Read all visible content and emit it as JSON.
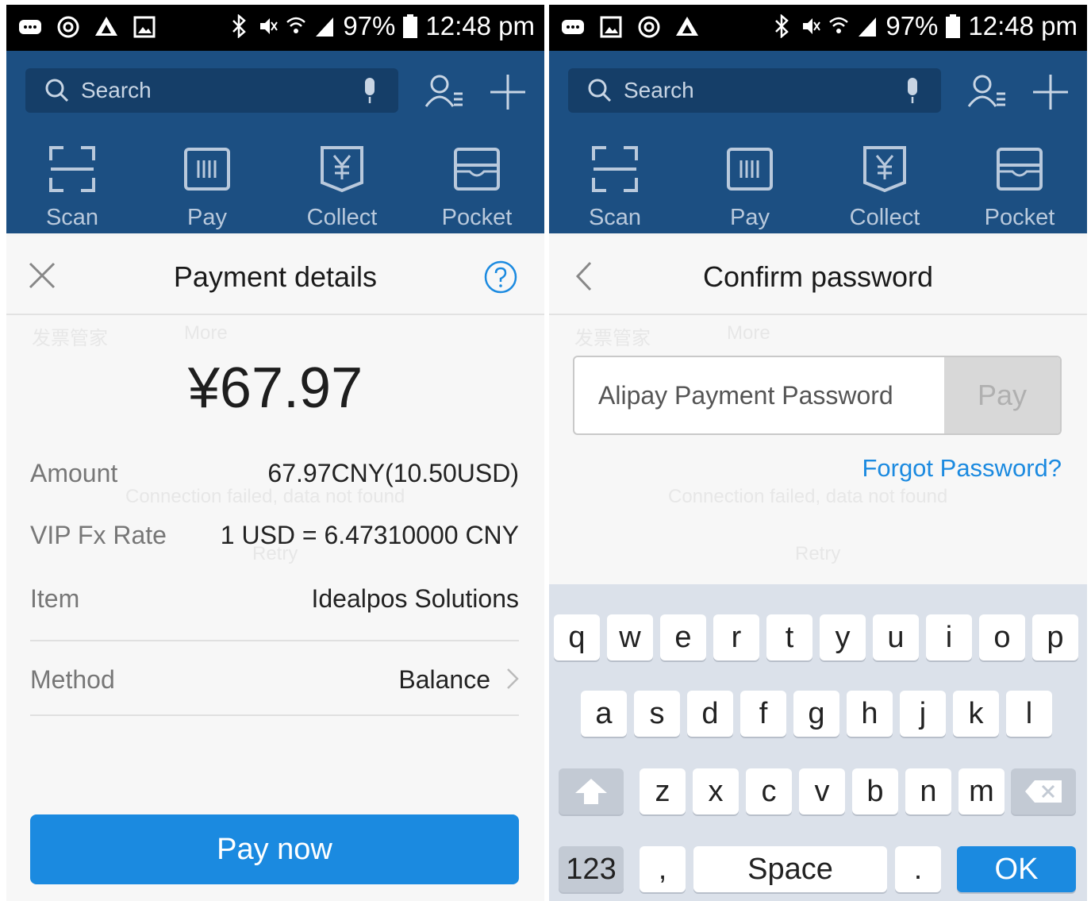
{
  "status_bar": {
    "battery": "97%",
    "time": "12:48 pm"
  },
  "header": {
    "search_placeholder": "Search",
    "quick_actions": [
      {
        "label": "Scan",
        "icon": "scan-icon"
      },
      {
        "label": "Pay",
        "icon": "barcode-icon"
      },
      {
        "label": "Collect",
        "icon": "yuan-collect-icon"
      },
      {
        "label": "Pocket",
        "icon": "pocket-icon"
      }
    ]
  },
  "background_ghost": {
    "app1": "发票管家",
    "app2": "More",
    "error": "Connection failed, data not found",
    "retry": "Retry"
  },
  "payment_details": {
    "title": "Payment details",
    "amount_display": "¥67.97",
    "rows": [
      {
        "label": "Amount",
        "value": "67.97CNY(10.50USD)"
      },
      {
        "label": "VIP Fx Rate",
        "value": "1 USD = 6.47310000 CNY"
      },
      {
        "label": "Item",
        "value": "Idealpos Solutions"
      }
    ],
    "method_label": "Method",
    "method_value": "Balance",
    "pay_now": "Pay now"
  },
  "confirm_password": {
    "title": "Confirm password",
    "input_placeholder": "Alipay Payment Password",
    "pay_button": "Pay",
    "forgot": "Forgot Password?"
  },
  "keyboard": {
    "row1": [
      "q",
      "w",
      "e",
      "r",
      "t",
      "y",
      "u",
      "i",
      "o",
      "p"
    ],
    "row2": [
      "a",
      "s",
      "d",
      "f",
      "g",
      "h",
      "j",
      "k",
      "l"
    ],
    "row3": [
      "z",
      "x",
      "c",
      "v",
      "b",
      "n",
      "m"
    ],
    "numbers": "123",
    "comma": ",",
    "space": "Space",
    "period": ".",
    "ok": "OK"
  },
  "colors": {
    "header_blue": "#1c4f82",
    "accent_blue": "#1b8ae0",
    "keyboard_bg": "#dbe1ea"
  }
}
